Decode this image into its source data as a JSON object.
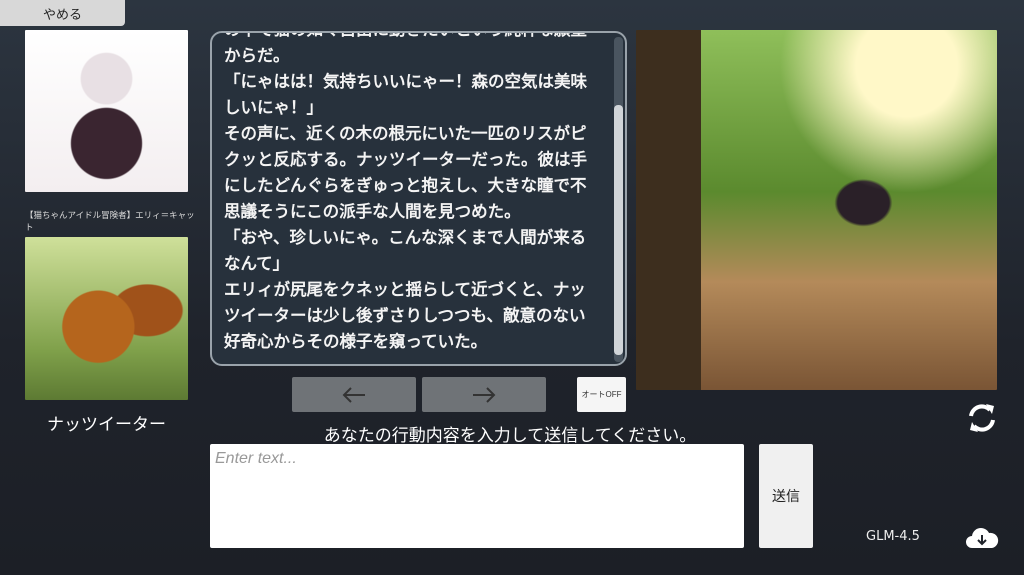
{
  "header": {
    "quit_label": "やめる"
  },
  "characters": {
    "player_caption": "【猫ちゃんアイドル冒険者】エリィ＝キャット",
    "npc_name": "ナッツイーター"
  },
  "story": {
    "lines": [
      "の中で猫の如く自由に動きたいという純粋な願望",
      "からだ。",
      "「にゃはは！気持ちいいにゃー！森の空気は美味",
      "しいにゃ！」",
      "その声に、近くの木の根元にいた一匹のリスがピ",
      "クッと反応する。ナッツイーターだった。彼は手",
      "にしたどんぐらをぎゅっと抱えし、大きな瞳で不",
      "思議そうにこの派手な人間を見つめた。",
      "「おや、珍しいにゃ。こんな深くまで人間が来る",
      "なんて」",
      "エリィが尻尾をクネッと揺らして近づくと、ナッ",
      "ツイーターは少し後ずさりしつつも、敵意のない",
      "好奇心からその様子を窺っていた。"
    ]
  },
  "controls": {
    "prev_icon": "arrow-left-icon",
    "next_icon": "arrow-right-icon",
    "auto_label": "オートOFF"
  },
  "input": {
    "prompt": "あなたの行動内容を入力して送信してください。",
    "placeholder": "Enter text...",
    "value": "",
    "send_label": "送信"
  },
  "footer": {
    "model": "GLM-4.5"
  }
}
